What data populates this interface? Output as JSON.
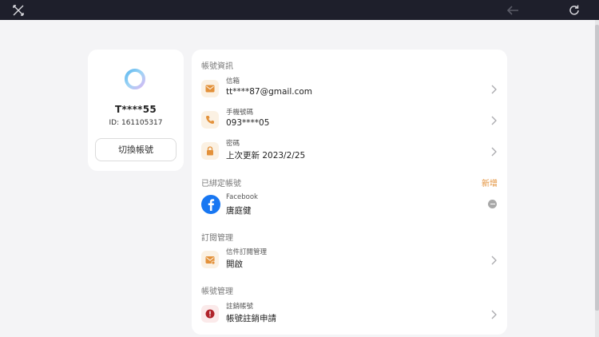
{
  "window": {
    "close_icon": "close-icon",
    "back_icon": "arrow-left-icon",
    "refresh_icon": "refresh-icon"
  },
  "profile": {
    "name": "T****55",
    "id_text": "ID: 161105317",
    "switch_label": "切換帳號"
  },
  "account_info": {
    "title": "帳號資訊",
    "email": {
      "label": "信箱",
      "value": "tt****87@gmail.com",
      "icon": "mail-icon"
    },
    "phone": {
      "label": "手機號碼",
      "value": "093****05",
      "icon": "phone-icon"
    },
    "password": {
      "label": "密碼",
      "value": "上次更新 2023/2/25",
      "icon": "lock-icon"
    }
  },
  "linked_accounts": {
    "title": "已綁定帳號",
    "add_label": "新增",
    "items": [
      {
        "provider": "Facebook",
        "name": "唐庭健",
        "icon": "facebook-icon"
      }
    ]
  },
  "subscription": {
    "title": "訂閱管理",
    "mail_sub": {
      "label": "信件訂閱管理",
      "value": "開啟",
      "icon": "mail-subscribe-icon"
    }
  },
  "account_mgmt": {
    "title": "帳號管理",
    "delete": {
      "label": "註銷帳號",
      "value": "帳號註銷申請",
      "icon": "alert-icon"
    }
  },
  "colors": {
    "topbar": "#1e1f2b",
    "accent_orange": "#e3913a",
    "facebook_blue": "#1877f2",
    "danger_red": "#b0232a"
  }
}
